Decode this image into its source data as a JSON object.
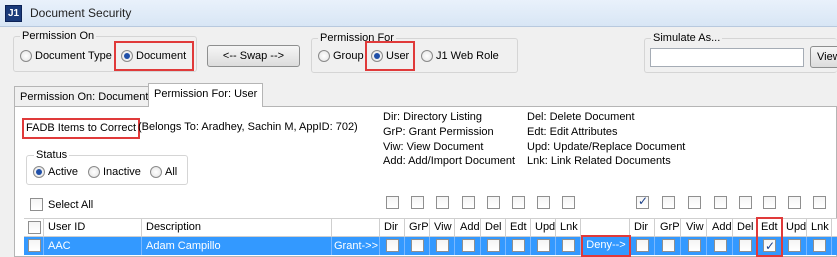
{
  "window": {
    "icon_text": "J1",
    "title": "Document Security"
  },
  "permission_on": {
    "label": "Permission On",
    "options": [
      "Document Type",
      "Document"
    ],
    "selected": "Document"
  },
  "swap_button": "<-- Swap -->",
  "permission_for": {
    "label": "Permission For",
    "options": [
      "Group",
      "User",
      "J1 Web Role"
    ],
    "selected": "User"
  },
  "simulate": {
    "label": "Simulate As...",
    "value": "",
    "button": "View"
  },
  "tabs": [
    {
      "label": "Permission On: Document",
      "active": false
    },
    {
      "label": "Permission For: User",
      "active": true
    }
  ],
  "document": {
    "name": "FADB Items to Correct",
    "belongs_to": "(Belongs To: Aradhey, Sachin M, AppID: 702)"
  },
  "legend_left": [
    "Dir:   Directory Listing",
    "GrP:  Grant Permission",
    "Viw:  View Document",
    "Add:  Add/Import Document"
  ],
  "legend_right": [
    "Del:  Delete Document",
    "Edt:  Edit Attributes",
    "Upd:  Update/Replace Document",
    "Lnk:  Link Related Documents"
  ],
  "status": {
    "label": "Status",
    "options": [
      "Active",
      "Inactive",
      "All"
    ],
    "selected": "Active"
  },
  "select_all_label": "Select All",
  "columns": {
    "user_id": "User ID",
    "description": "Description",
    "grant_perms": [
      "Dir",
      "GrP",
      "Viw",
      "Add",
      "Del",
      "Edt",
      "Upd",
      "Lnk"
    ],
    "deny_perms": [
      "Dir",
      "GrP",
      "Viw",
      "Add",
      "Del",
      "Edt",
      "Upd",
      "Lnk"
    ]
  },
  "header_checks": {
    "grant": [
      false,
      false,
      false,
      false,
      false,
      false,
      false,
      false
    ],
    "deny": [
      true,
      false,
      false,
      false,
      false,
      false,
      false,
      false
    ]
  },
  "rows": [
    {
      "user_id": "AAC",
      "description": "Adam Campillo",
      "grant_label": "Grant->>",
      "deny_label": "Deny-->",
      "grant": [
        false,
        false,
        false,
        false,
        false,
        false,
        false,
        false
      ],
      "deny": [
        false,
        false,
        false,
        false,
        false,
        true,
        false,
        false
      ]
    }
  ],
  "colors": {
    "selection": "#3399ff",
    "highlight": "#e03a3a"
  }
}
